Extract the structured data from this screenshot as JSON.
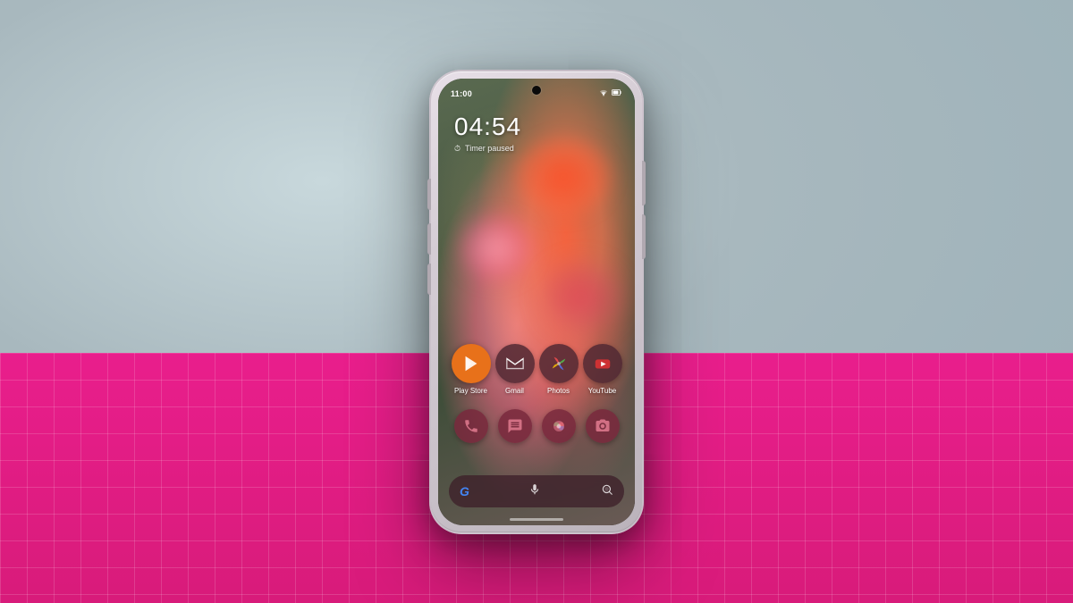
{
  "background": {
    "color": "#b0bec5"
  },
  "table": {
    "color": "#e91e8c"
  },
  "phone": {
    "shell_color": "#d4ccd4",
    "screen": {
      "status_bar": {
        "time": "11:00",
        "icons": [
          "wifi",
          "battery"
        ]
      },
      "lock_info": {
        "time": "04:54",
        "notification_icon": "⏱",
        "notification_text": "Timer paused"
      },
      "apps_row1": [
        {
          "id": "play-store",
          "label": "Play Store",
          "icon_type": "play-store"
        },
        {
          "id": "gmail",
          "label": "Gmail",
          "icon_type": "dark"
        },
        {
          "id": "photos",
          "label": "Photos",
          "icon_type": "dark"
        },
        {
          "id": "youtube",
          "label": "YouTube",
          "icon_type": "dark"
        }
      ],
      "apps_row2": [
        {
          "id": "phone",
          "label": "",
          "icon_type": "dark-small"
        },
        {
          "id": "messages",
          "label": "",
          "icon_type": "dark-small"
        },
        {
          "id": "chrome",
          "label": "",
          "icon_type": "dark-small"
        },
        {
          "id": "camera",
          "label": "",
          "icon_type": "dark-small"
        }
      ],
      "search_bar": {
        "g_label": "G",
        "mic_label": "🎤",
        "lens_label": "⊙"
      }
    }
  }
}
